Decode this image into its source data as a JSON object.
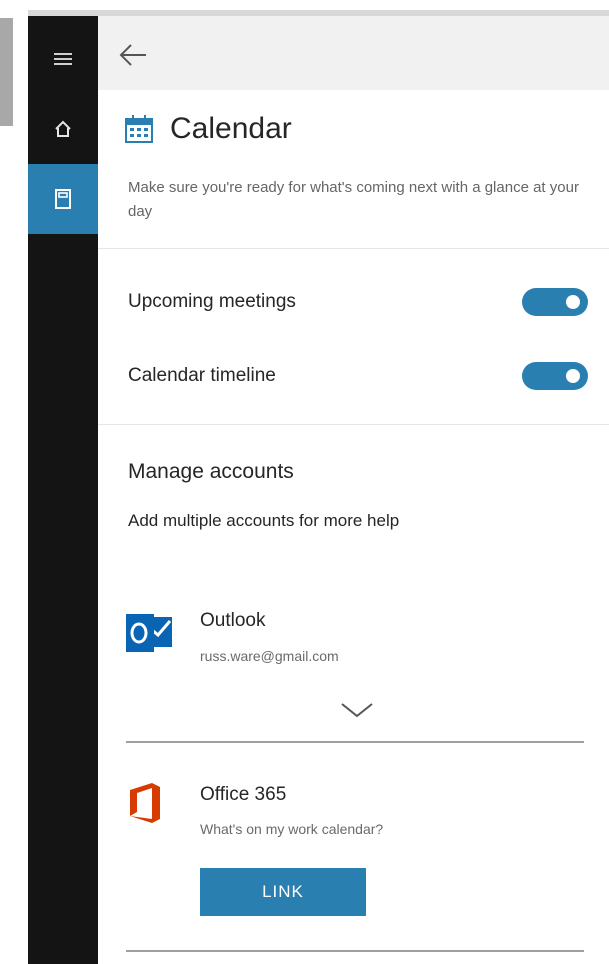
{
  "nav": {
    "items": [
      {
        "icon": "hamburger-menu-icon"
      },
      {
        "icon": "home-icon"
      },
      {
        "icon": "notebook-icon",
        "active": true
      }
    ]
  },
  "header": {
    "back_icon": "back-arrow-icon"
  },
  "calendar": {
    "icon": "calendar-icon",
    "title": "Calendar",
    "description": "Make sure you're ready for what's coming next with a glance at your day"
  },
  "settings": {
    "upcoming_meetings": {
      "label": "Upcoming meetings",
      "on": true
    },
    "calendar_timeline": {
      "label": "Calendar timeline",
      "on": true
    }
  },
  "accounts": {
    "title": "Manage accounts",
    "subtitle": "Add multiple accounts for more help",
    "outlook": {
      "name": "Outlook",
      "email": "russ.ware@gmail.com"
    },
    "office365": {
      "name": "Office 365",
      "prompt": "What's on my work calendar?",
      "button": "LINK"
    }
  },
  "colors": {
    "accent": "#2a7fb1",
    "outlook_blue": "#0a64b4",
    "office_orange": "#d83b01",
    "nav_bg": "#141414"
  }
}
